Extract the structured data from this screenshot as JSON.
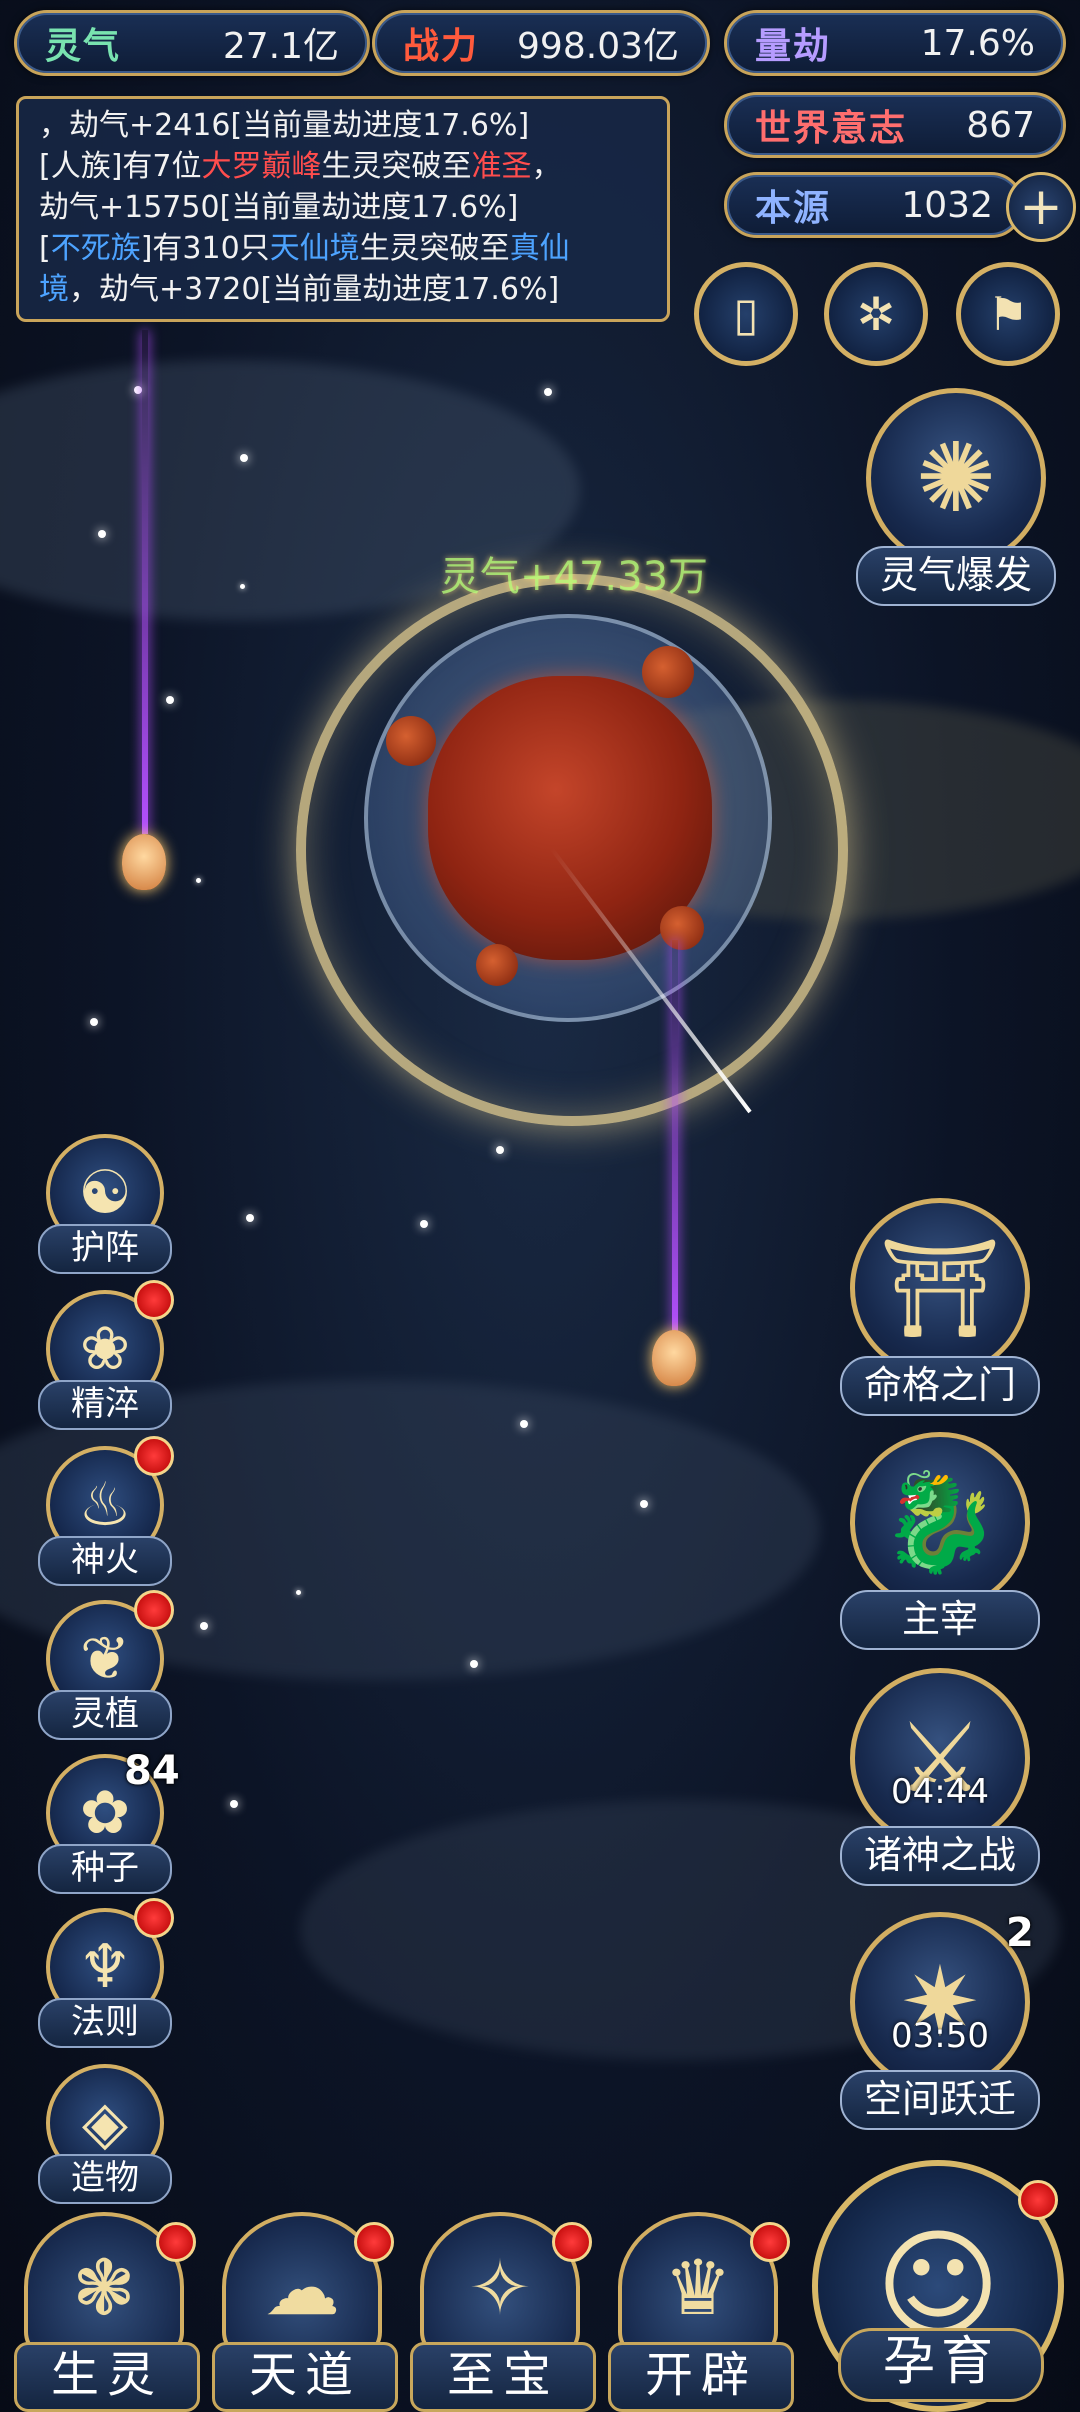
{
  "stats": {
    "lingqi": {
      "label": "灵气",
      "value": "27.1亿",
      "label_color": "#79e3b0"
    },
    "zhanli": {
      "label": "战力",
      "value": "998.03亿",
      "label_color": "#ff5a3c"
    },
    "liangjie": {
      "label": "量劫",
      "value": "17.6%",
      "label_color": "#b69cff"
    },
    "shijie": {
      "label": "世界意志",
      "value": "867",
      "label_color": "#ff6e6e"
    },
    "benyuan": {
      "label": "本源",
      "value": "1032",
      "label_color": "#8fb3ff"
    },
    "plus_icon": "+"
  },
  "log": {
    "line1": "，劫气+2416[当前量劫进度17.6%]",
    "line2_a": "[人族]有7位",
    "line2_red": "大罗巅峰",
    "line2_b": "生灵突破至",
    "line2_red2": "准圣",
    "line2_c": "，",
    "line3": "劫气+15750[当前量劫进度17.6%]",
    "line4_a": "[",
    "line4_blue": "不死族",
    "line4_b": "]有310只",
    "line4_blue2": "天仙境",
    "line4_c": "生灵突破至",
    "line4_blue3": "真仙",
    "line5_blue": "境",
    "line5_rest": "，劫气+3720[当前量劫进度17.6%]"
  },
  "world": {
    "gain_text": "灵气+47.33万"
  },
  "left_menu": [
    {
      "name": "protect",
      "label": "护阵",
      "icon": "☯",
      "badge": false
    },
    {
      "name": "refine",
      "label": "精淬",
      "icon": "❀",
      "badge": true
    },
    {
      "name": "fire",
      "label": "神火",
      "icon": "♨",
      "badge": true
    },
    {
      "name": "plant",
      "label": "灵植",
      "icon": "❦",
      "badge": true
    },
    {
      "name": "seed",
      "label": "种子",
      "icon": "✿",
      "badge_count": "84"
    },
    {
      "name": "law",
      "label": "法则",
      "icon": "♆",
      "badge": true
    },
    {
      "name": "create",
      "label": "造物",
      "icon": "◈",
      "badge": false
    }
  ],
  "right_menu": {
    "burst": {
      "label": "灵气爆发",
      "icon": "✺"
    },
    "fate": {
      "label": "命格之门",
      "icon": "⛩"
    },
    "ruler": {
      "label": "主宰",
      "icon": "🐉"
    },
    "gods": {
      "label": "诸神之战",
      "icon": "⚔",
      "timer": "04:44"
    },
    "jump": {
      "label": "空间跃迁",
      "icon": "✷",
      "timer": "03:50",
      "count": "2"
    }
  },
  "bottom_bar": [
    {
      "name": "creature",
      "label": "生灵",
      "icon": "❃"
    },
    {
      "name": "heaven",
      "label": "天道",
      "icon": "☁"
    },
    {
      "name": "treasure",
      "label": "至宝",
      "icon": "✧"
    },
    {
      "name": "open",
      "label": "开辟",
      "icon": "♛"
    }
  ],
  "big_button": {
    "label": "孕育",
    "icon": "☺"
  }
}
